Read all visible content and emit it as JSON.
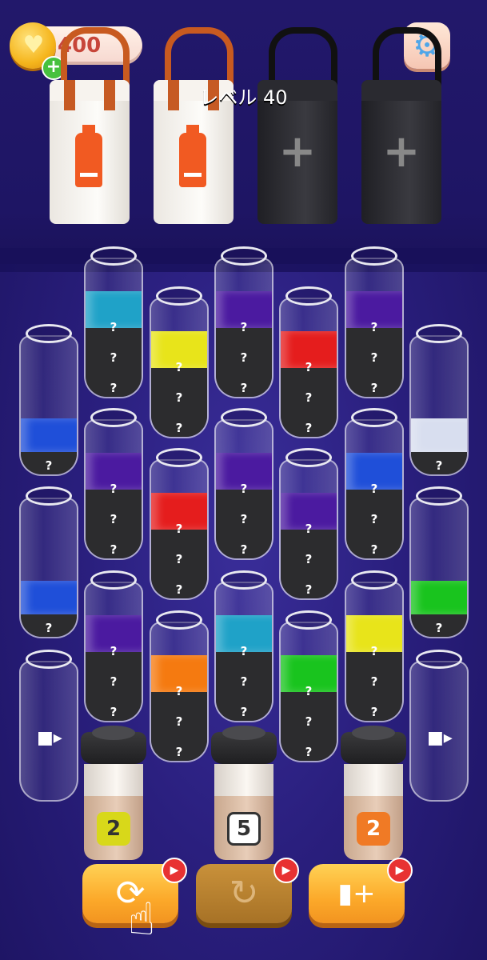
{
  "currency": {
    "amount": "400",
    "heart_icon": "heart-icon",
    "add_icon": "plus-icon"
  },
  "level": {
    "label": "レベル 40"
  },
  "settings": {
    "icon": "gear-icon"
  },
  "bags": [
    {
      "state": "filled",
      "icon": "bottle-icon",
      "color": "#f15a22"
    },
    {
      "state": "filled",
      "icon": "bottle-icon",
      "color": "#f15a22"
    },
    {
      "state": "locked",
      "icon": "plus-icon"
    },
    {
      "state": "locked",
      "icon": "plus-icon"
    }
  ],
  "tubes": [
    {
      "color": "#1fa2c8",
      "fill": 0.75,
      "hidden": 3
    },
    {
      "color": "#e8e41a",
      "fill": 0.75,
      "hidden": 3
    },
    {
      "color": "#4b1aa0",
      "fill": 0.75,
      "hidden": 3
    },
    {
      "color": "#e51d1d",
      "fill": 0.75,
      "hidden": 3
    },
    {
      "color": "#4b1aa0",
      "fill": 0.75,
      "hidden": 3
    },
    {
      "color": "#1f4fd9",
      "fill": 0.4,
      "hidden": 1
    },
    {
      "color": "#d8deef",
      "fill": 0.4,
      "hidden": 1
    },
    {
      "color": "#4b1aa0",
      "fill": 0.75,
      "hidden": 3
    },
    {
      "color": "#e51d1d",
      "fill": 0.75,
      "hidden": 3
    },
    {
      "color": "#4b1aa0",
      "fill": 0.75,
      "hidden": 3
    },
    {
      "color": "#4b1aa0",
      "fill": 0.75,
      "hidden": 3
    },
    {
      "color": "#1f4fd9",
      "fill": 0.75,
      "hidden": 3
    },
    {
      "color": "#1f4fd9",
      "fill": 0.4,
      "hidden": 1
    },
    {
      "color": "#19c41e",
      "fill": 0.4,
      "hidden": 1
    },
    {
      "color": "#4b1aa0",
      "fill": 0.75,
      "hidden": 3
    },
    {
      "color": "#f57a10",
      "fill": 0.75,
      "hidden": 3
    },
    {
      "color": "#1fa2c8",
      "fill": 0.75,
      "hidden": 3
    },
    {
      "color": "#19c41e",
      "fill": 0.75,
      "hidden": 3
    },
    {
      "color": "#e8e41a",
      "fill": 0.75,
      "hidden": 3
    },
    {
      "locked": true,
      "icon": "video-camera-icon"
    },
    {
      "locked": true,
      "icon": "video-camera-icon"
    }
  ],
  "hidden_marker": "?",
  "cups": [
    {
      "count": "2",
      "badge_color": "#d8d81a"
    },
    {
      "count": "5",
      "badge_color": "#ffffff"
    },
    {
      "count": "2",
      "badge_color": "#f07a25"
    }
  ],
  "actions": [
    {
      "name": "shuffle",
      "icon": "shuffle-icon",
      "enabled": true,
      "ad": true
    },
    {
      "name": "undo",
      "icon": "undo-icon",
      "enabled": false,
      "ad": true
    },
    {
      "name": "add-bottle",
      "icon": "add-bottle-icon",
      "enabled": true,
      "ad": true
    }
  ],
  "colors": {
    "background": "#2a1f7e",
    "button": "#fca92a",
    "ad_badge": "#e83232"
  }
}
